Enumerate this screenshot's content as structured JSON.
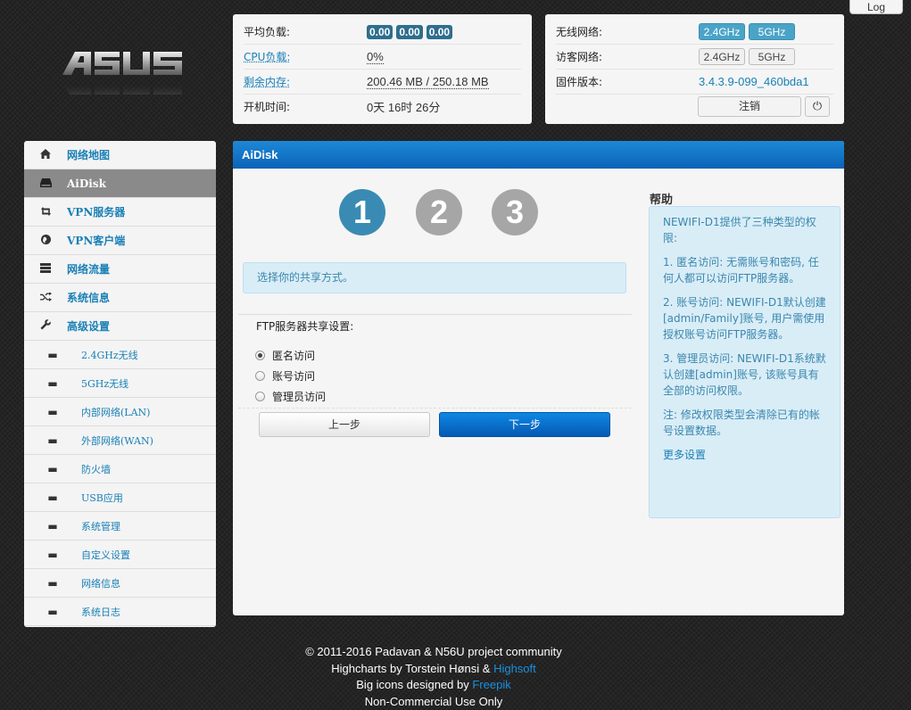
{
  "top": {
    "log_label": "Log"
  },
  "status_left": {
    "load_label": "平均负载:",
    "load_values": [
      "0.00",
      "0.00",
      "0.00"
    ],
    "cpu_label": "CPU负载:",
    "cpu_value": "0%",
    "mem_label": "剩余内存:",
    "mem_value": "200.46 MB / 250.18 MB",
    "uptime_label": "开机时间:",
    "uptime_value": "0天 16时 26分"
  },
  "status_right": {
    "wifi_label": "无线网络:",
    "wifi_24": "2.4GHz",
    "wifi_5": "5GHz",
    "guest_label": "访客网络:",
    "guest_24": "2.4GHz",
    "guest_5": "5GHz",
    "fw_label": "固件版本:",
    "fw_value": "3.4.3.9-099_460bda1",
    "logout_label": "注销"
  },
  "sidebar": {
    "items": [
      {
        "label": "网络地图",
        "icon": "home-icon"
      },
      {
        "label": "AiDisk",
        "icon": "disk-icon",
        "active": true
      },
      {
        "label": "VPN服务器",
        "icon": "retweet-icon"
      },
      {
        "label": "VPN客户端",
        "icon": "globe-icon"
      },
      {
        "label": "网络流量",
        "icon": "tasks-icon"
      },
      {
        "label": "系统信息",
        "icon": "random-icon"
      },
      {
        "label": "高级设置",
        "icon": "wrench-icon"
      }
    ],
    "sub_items": [
      {
        "label": "2.4GHz无线"
      },
      {
        "label": "5GHz无线"
      },
      {
        "label": "内部网络(LAN)"
      },
      {
        "label": "外部网络(WAN)"
      },
      {
        "label": "防火墙"
      },
      {
        "label": "USB应用"
      },
      {
        "label": "系统管理"
      },
      {
        "label": "自定义设置"
      },
      {
        "label": "网络信息"
      },
      {
        "label": "系统日志"
      }
    ]
  },
  "main": {
    "title": "AiDisk",
    "steps": [
      "1",
      "2",
      "3"
    ],
    "info": "选择你的共享方式。",
    "ftp_title": "FTP服务器共享设置:",
    "options": [
      {
        "label": "匿名访问",
        "checked": true
      },
      {
        "label": "账号访问",
        "checked": false
      },
      {
        "label": "管理员访问",
        "checked": false
      }
    ],
    "prev_label": "上一步",
    "next_label": "下一步",
    "help_title": "帮助",
    "help_paragraphs": [
      "NEWIFI-D1提供了三种类型的权限:",
      "1. 匿名访问: 无需账号和密码, 任何人都可以访问FTP服务器。",
      "2. 账号访问: NEWIFI-D1默认创建[admin/Family]账号, 用户需使用授权账号访问FTP服务器。",
      "3. 管理员访问: NEWIFI-D1系统默认创建[admin]账号, 该账号具有全部的访问权限。",
      "注: 修改权限类型会清除已有的帐号设置数据。"
    ],
    "help_more": "更多设置"
  },
  "footer": {
    "line1": "© 2011-2016 Padavan & N56U project community",
    "line2_prefix": "Highcharts by Torstein Hønsi & ",
    "line2_link": "Highsoft",
    "line3_prefix": "Big icons designed by ",
    "line3_link": "Freepik",
    "line4": "Non-Commercial Use Only"
  },
  "colors": {
    "accent": "#1a80b6",
    "header_blue": "#0a63b8",
    "info_bg": "#d9edf7",
    "step_active": "#3a8bb4",
    "step_inactive": "#a6a6a6"
  }
}
